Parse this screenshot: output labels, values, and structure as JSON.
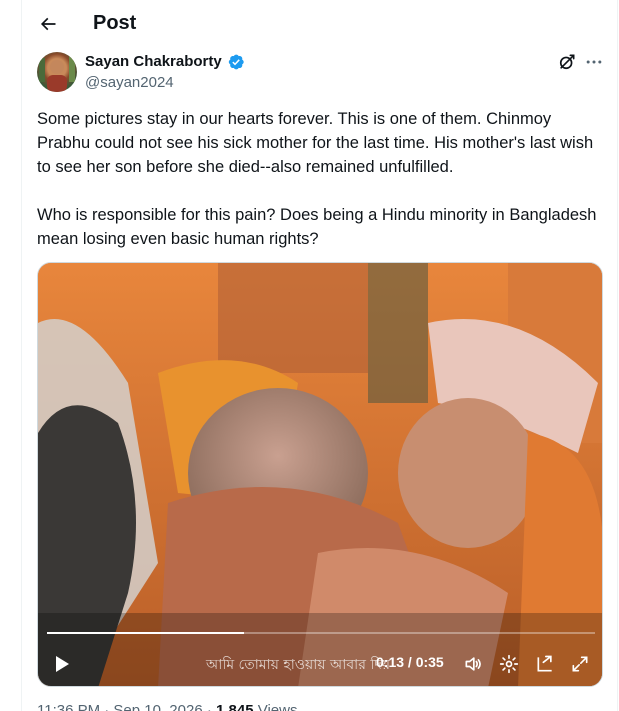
{
  "header": {
    "title": "Post"
  },
  "post": {
    "author_name": "Sayan Chakraborty",
    "author_handle": "@sayan2024",
    "text": "Some pictures stay in our hearts forever. This is one of them. Chinmoy Prabhu could not see his sick mother for the last time. His mother's last wish to see her son before she died--also remained unfulfilled.\n\nWho is responsible for this pain? Does being a Hindu minority in Bangladesh mean losing even basic human rights?",
    "timestamp": "11:36 PM · Sep 10, 2026 · ",
    "views_count": "1,845",
    "views_label": "Views"
  },
  "video": {
    "caption": "আমি তোমায় হাওয়ায় আবার দিয়",
    "time": "0:13 / 0:35",
    "progress": 0.36
  },
  "icons": {
    "back": "back-arrow-icon",
    "verified": "verified-badge-icon",
    "grok": "grok-icon",
    "more": "more-icon",
    "play": "play-icon",
    "volume": "volume-icon",
    "settings": "settings-icon",
    "pip": "picture-in-picture-icon",
    "fullscreen": "fullscreen-icon"
  },
  "colors": {
    "verified": "#1d9bf0",
    "text": "#0f1419",
    "secondary": "#536471"
  }
}
